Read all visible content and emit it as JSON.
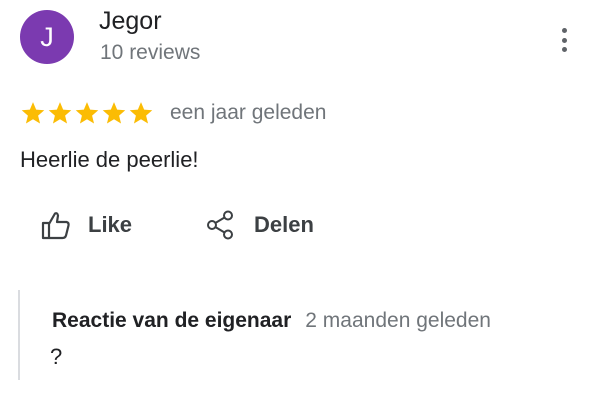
{
  "author": {
    "initial": "J",
    "name": "Jegor",
    "meta": "10 reviews",
    "avatar_color": "#7b3ab0"
  },
  "more_icon": "more-vert-icon",
  "rating": {
    "stars": 5,
    "max_stars": 5,
    "star_color": "#fbbc04",
    "time": "een jaar geleden"
  },
  "review": {
    "text": "Heerlie de peerlie!"
  },
  "actions": {
    "like": {
      "label": "Like",
      "icon": "thumbs-up-icon"
    },
    "share": {
      "label": "Delen",
      "icon": "share-icon"
    }
  },
  "owner_reply": {
    "title": "Reactie van de eigenaar",
    "time": "2 maanden geleden",
    "text": "?"
  }
}
